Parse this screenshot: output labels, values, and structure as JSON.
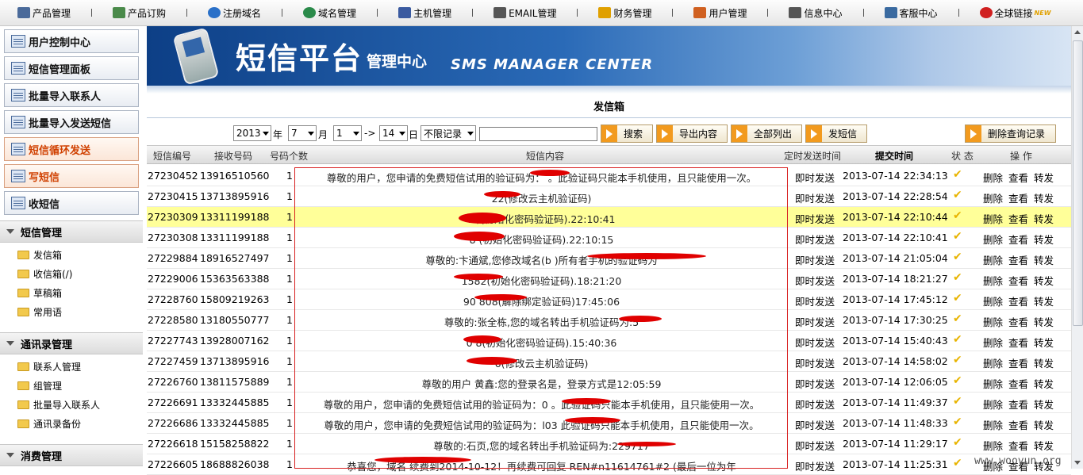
{
  "topnav": [
    {
      "label": "产品管理",
      "icon": "edit-icon"
    },
    {
      "label": "产品订购",
      "icon": "cart-icon"
    },
    {
      "label": "注册域名",
      "icon": "globe-icon"
    },
    {
      "label": "域名管理",
      "icon": "globe-icon"
    },
    {
      "label": "主机管理",
      "icon": "server-icon"
    },
    {
      "label": "EMAIL管理",
      "icon": "mail-icon"
    },
    {
      "label": "财务管理",
      "icon": "coins-icon"
    },
    {
      "label": "用户管理",
      "icon": "user-icon"
    },
    {
      "label": "信息中心",
      "icon": "document-icon"
    },
    {
      "label": "客服中心",
      "icon": "support-icon"
    },
    {
      "label": "全球链接",
      "icon": "link-icon",
      "badge": "NEW"
    }
  ],
  "sidebar": {
    "buttons": [
      "用户控制中心",
      "短信管理面板",
      "批量导入联系人",
      "批量导入发送短信",
      "短信循环发送",
      "写短信",
      "收短信"
    ],
    "sections": [
      {
        "title": "短信管理",
        "items": [
          "发信箱",
          "收信箱(/)",
          "草稿箱",
          "常用语"
        ]
      },
      {
        "title": "通讯录管理",
        "items": [
          "联系人管理",
          "组管理",
          "批量导入联系人",
          "通讯录备份"
        ]
      },
      {
        "title": "消费管理",
        "items": []
      }
    ]
  },
  "banner": {
    "title": "短信平台",
    "subtitle": "管理中心",
    "english": "SMS MANAGER CENTER"
  },
  "page_title": "发信箱",
  "filter": {
    "year": "2013",
    "year_unit": "年",
    "month": "7",
    "month_unit": "月",
    "day_from": "1",
    "arrow": "->",
    "day_to": "14",
    "day_unit": "日",
    "limit": "不限记录",
    "search": "搜索",
    "export": "导出内容",
    "list_all": "全部列出",
    "send": "发短信",
    "delete_records": "删除查询记录"
  },
  "table": {
    "headers": {
      "id": "短信编号",
      "phone": "接收号码",
      "count": "号码个数",
      "content": "短信内容",
      "timing": "定时发送时间",
      "submit": "提交时间",
      "status": "状 态",
      "ops": "操 作"
    },
    "actions": {
      "delete": "删除",
      "view": "查看",
      "forward": "转发"
    },
    "rows": [
      {
        "id": "27230452",
        "phone": "13916510560",
        "count": "1",
        "content": "尊敬的用户，您申请的免费短信试用的验证码为：      。此验证码只能本手机使用，且只能使用一次。",
        "timing": "即时发送",
        "submit": "2013-07-14 22:34:13"
      },
      {
        "id": "27230415",
        "phone": "13713895916",
        "count": "1",
        "content": "      22(修改云主机验证码)",
        "timing": "即时发送",
        "submit": "2013-07-14 22:28:54"
      },
      {
        "id": "27230309",
        "phone": "13311199188",
        "count": "1",
        "content": "1      /(初始化密码验证码).22:10:41",
        "timing": "即时发送",
        "submit": "2013-07-14 22:10:44"
      },
      {
        "id": "27230308",
        "phone": "13311199188",
        "count": "1",
        "content": "8      (初始化密码验证码).22:10:15",
        "timing": "即时发送",
        "submit": "2013-07-14 22:10:41"
      },
      {
        "id": "27229884",
        "phone": "18916527497",
        "count": "1",
        "content": "尊敬的:卞通斌,您修改域名(b            )所有者手机的验证码为",
        "timing": "即时发送",
        "submit": "2013-07-14 21:05:04"
      },
      {
        "id": "27229006",
        "phone": "15363563388",
        "count": "1",
        "content": "      1582(初始化密码验证码).18:21:20",
        "timing": "即时发送",
        "submit": "2013-07-14 18:21:27"
      },
      {
        "id": "27228760",
        "phone": "15809219263",
        "count": "1",
        "content": "90      808(解除绑定验证码)17:45:06",
        "timing": "即时发送",
        "submit": "2013-07-14 17:45:12"
      },
      {
        "id": "27228580",
        "phone": "13180550777",
        "count": "1",
        "content": "尊敬的:张全栋,您的域名转出手机验证码为:5",
        "timing": "即时发送",
        "submit": "2013-07-14 17:30:25"
      },
      {
        "id": "27227743",
        "phone": "13928007162",
        "count": "1",
        "content": "0      8(初始化密码验证码).15:40:36",
        "timing": "即时发送",
        "submit": "2013-07-14 15:40:43"
      },
      {
        "id": "27227459",
        "phone": "13713895916",
        "count": "1",
        "content": "      6(修改云主机验证码)",
        "timing": "即时发送",
        "submit": "2013-07-14 14:58:02"
      },
      {
        "id": "27226760",
        "phone": "13811575889",
        "count": "1",
        "content": "尊敬的用户 黄鑫:您的登录名是，登录方式是12:05:59",
        "timing": "即时发送",
        "submit": "2013-07-14 12:06:05"
      },
      {
        "id": "27226691",
        "phone": "13332445885",
        "count": "1",
        "content": "尊敬的用户，您申请的免费短信试用的验证码为：0      。此验证码只能本手机使用，且只能使用一次。",
        "timing": "即时发送",
        "submit": "2013-07-14 11:49:37"
      },
      {
        "id": "27226686",
        "phone": "13332445885",
        "count": "1",
        "content": "尊敬的用户，您申请的免费短信试用的验证码为：l03      此验证码只能本手机使用，且只能使用一次。",
        "timing": "即时发送",
        "submit": "2013-07-14 11:48:33"
      },
      {
        "id": "27226618",
        "phone": "15158258822",
        "count": "1",
        "content": "尊敬的:石页,您的域名转出手机验证码为:229717",
        "timing": "即时发送",
        "submit": "2013-07-14 11:29:17"
      },
      {
        "id": "27226605",
        "phone": "18688826038",
        "count": "1",
        "content": "恭喜您，域名            续费到2014-10-12！再续费可回复 REN#n11614761#2 (最后一位为年",
        "timing": "即时发送",
        "submit": "2013-07-14 11:25:31"
      }
    ],
    "highlighted_row_index": 2,
    "status_icon": "checkmark-icon",
    "status_color": "#e8b400",
    "highlight_color": "#ffff99"
  },
  "watermark": "www.wooyun.org"
}
